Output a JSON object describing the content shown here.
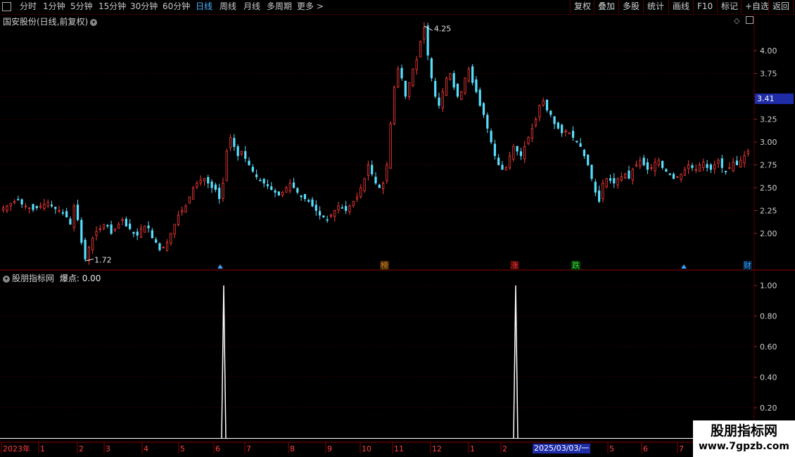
{
  "toolbar": {
    "periods": [
      "分时",
      "1分钟",
      "5分钟",
      "15分钟",
      "30分钟",
      "60分钟",
      "日线",
      "周线",
      "月线",
      "多周期",
      "更多 >"
    ],
    "active_period": "日线",
    "right_buttons": [
      "复权",
      "叠加",
      "多股",
      "统计",
      "画线",
      "F10",
      "标记",
      "+自选",
      "返回"
    ]
  },
  "main_chart": {
    "title": "国安股份(日线,前复权)",
    "high_label": "4.25",
    "low_label": "1.72",
    "current_price": "3.41",
    "y_ticks": [
      "4.00",
      "3.75",
      "3.50",
      "3.25",
      "3.00",
      "2.75",
      "2.50",
      "2.25",
      "2.00"
    ],
    "events": [
      {
        "label": "榜",
        "color": "#e08a2a"
      },
      {
        "label": "涨",
        "color": "#ff4040"
      },
      {
        "label": "跌",
        "color": "#40d040"
      },
      {
        "label": "财",
        "color": "#40a0ff"
      }
    ]
  },
  "sub_chart": {
    "title": "股朋指标网",
    "indicator_label": "爆点: 0.00",
    "y_ticks": [
      "1.00",
      "0.80",
      "0.60",
      "0.40",
      "0.20"
    ]
  },
  "x_axis": {
    "labels": [
      "2023年",
      "1",
      "2",
      "3",
      "4",
      "5",
      "6",
      "7",
      "8",
      "9",
      "10",
      "11",
      "12",
      "1",
      "2",
      "5",
      "6",
      "7"
    ],
    "cursor_date": "2025/03/03/一"
  },
  "watermark": {
    "title": "股朋指标网",
    "url": "www.7gpzb.com"
  },
  "colors": {
    "up": "#ff3b3b",
    "down": "#58e0ff",
    "grid": "#5a0000",
    "accent": "#1e2ca8"
  },
  "chart_data": {
    "type": "candlestick",
    "series": [
      {
        "values": [
          2.28,
          2.3,
          2.33,
          2.35,
          2.37,
          2.32,
          2.3,
          2.28,
          2.26,
          2.28,
          2.3,
          2.32,
          2.34,
          2.3,
          2.27,
          2.25,
          2.22,
          2.18,
          2.1,
          2.3,
          2.15,
          1.9,
          1.72,
          1.85,
          1.95,
          2.02,
          2.05,
          2.1,
          2.08,
          2.0,
          2.05,
          2.1,
          2.15,
          2.08,
          2.05,
          2.0,
          1.98,
          2.05,
          2.08,
          2.06,
          1.95,
          1.9,
          1.82,
          1.85,
          1.9,
          2.0,
          2.1,
          2.2,
          2.25,
          2.3,
          2.4,
          2.5,
          2.55,
          2.58,
          2.6,
          2.55,
          2.5,
          2.48,
          2.38,
          2.55,
          2.9,
          3.05,
          2.95,
          2.85,
          2.9,
          2.82,
          2.75,
          2.68,
          2.62,
          2.58,
          2.55,
          2.52,
          2.48,
          2.45,
          2.42,
          2.45,
          2.5,
          2.55,
          2.5,
          2.45,
          2.4,
          2.38,
          2.35,
          2.3,
          2.25,
          2.2,
          2.18,
          2.15,
          2.2,
          2.25,
          2.3,
          2.28,
          2.25,
          2.3,
          2.35,
          2.4,
          2.5,
          2.6,
          2.75,
          2.65,
          2.55,
          2.5,
          2.55,
          2.75,
          3.2,
          3.6,
          3.8,
          3.7,
          3.5,
          3.65,
          3.8,
          3.9,
          4.1,
          4.25,
          3.95,
          3.7,
          3.5,
          3.4,
          3.55,
          3.7,
          3.75,
          3.6,
          3.5,
          3.55,
          3.7,
          3.8,
          3.65,
          3.55,
          3.4,
          3.3,
          3.15,
          3.0,
          2.85,
          2.75,
          2.7,
          2.72,
          2.85,
          2.95,
          2.9,
          2.85,
          2.95,
          3.05,
          3.15,
          3.25,
          3.4,
          3.45,
          3.35,
          3.3,
          3.2,
          3.15,
          3.1,
          3.12,
          3.1,
          3.05,
          3.0,
          2.95,
          2.85,
          2.75,
          2.6,
          2.45,
          2.35,
          2.55,
          2.6,
          2.58,
          2.55,
          2.6,
          2.62,
          2.65,
          2.6,
          2.7,
          2.75,
          2.8,
          2.75,
          2.7,
          2.72,
          2.78,
          2.8,
          2.72,
          2.68,
          2.65,
          2.6,
          2.62,
          2.65,
          2.7,
          2.75,
          2.72,
          2.7,
          2.75,
          2.78,
          2.72,
          2.7,
          2.75,
          2.8,
          2.72,
          2.68,
          2.72,
          2.78,
          2.75,
          2.8,
          2.85,
          2.9
        ]
      }
    ],
    "indicator": {
      "name": "爆点",
      "spikes": 2,
      "peak_value": 1.0
    }
  }
}
